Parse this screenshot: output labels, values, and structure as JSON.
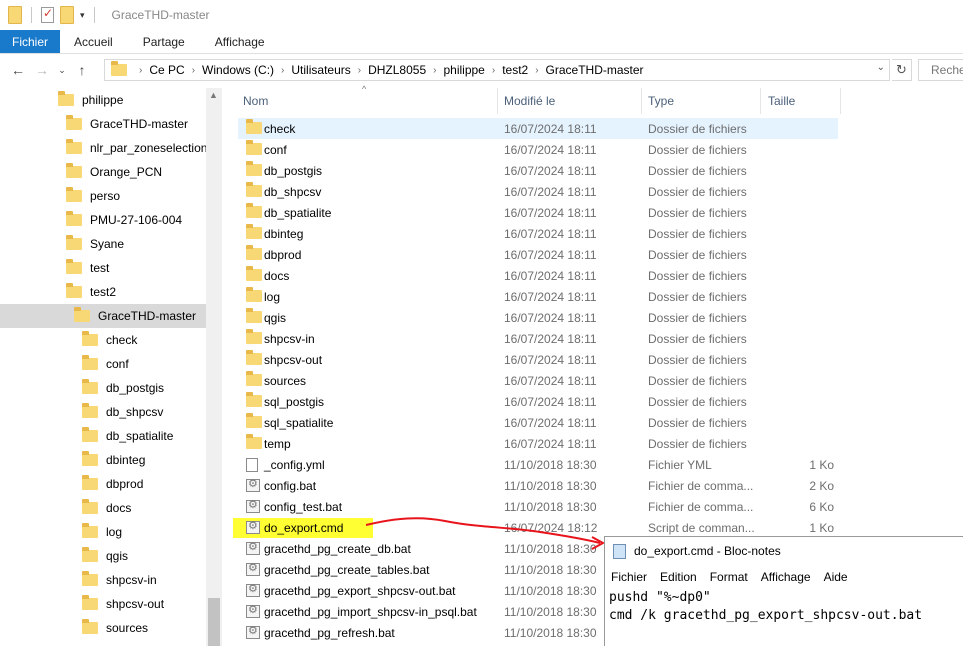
{
  "window": {
    "title": "GraceTHD-master"
  },
  "ribbon": {
    "tabs": [
      "Fichier",
      "Accueil",
      "Partage",
      "Affichage"
    ]
  },
  "address": {
    "crumbs": [
      "Ce PC",
      "Windows (C:)",
      "Utilisateurs",
      "DHZL8055",
      "philippe",
      "test2",
      "GraceTHD-master"
    ],
    "search_placeholder": "Reche"
  },
  "sidebar": {
    "items": [
      {
        "label": "philippe",
        "level": 0
      },
      {
        "label": "GraceTHD-master",
        "level": 1
      },
      {
        "label": "nlr_par_zoneselection_p",
        "level": 1
      },
      {
        "label": "Orange_PCN",
        "level": 1
      },
      {
        "label": "perso",
        "level": 1
      },
      {
        "label": "PMU-27-106-004",
        "level": 1
      },
      {
        "label": "Syane",
        "level": 1
      },
      {
        "label": "test",
        "level": 1
      },
      {
        "label": "test2",
        "level": 1
      },
      {
        "label": "GraceTHD-master",
        "level": 2,
        "selected": true
      },
      {
        "label": "check",
        "level": 3
      },
      {
        "label": "conf",
        "level": 3
      },
      {
        "label": "db_postgis",
        "level": 3
      },
      {
        "label": "db_shpcsv",
        "level": 3
      },
      {
        "label": "db_spatialite",
        "level": 3
      },
      {
        "label": "dbinteg",
        "level": 3
      },
      {
        "label": "dbprod",
        "level": 3
      },
      {
        "label": "docs",
        "level": 3
      },
      {
        "label": "log",
        "level": 3
      },
      {
        "label": "qgis",
        "level": 3
      },
      {
        "label": "shpcsv-in",
        "level": 3
      },
      {
        "label": "shpcsv-out",
        "level": 3
      },
      {
        "label": "sources",
        "level": 3
      }
    ]
  },
  "columns": {
    "name": "Nom",
    "modified": "Modifié le",
    "type": "Type",
    "size": "Taille"
  },
  "files": [
    {
      "name": "check",
      "date": "16/07/2024 18:11",
      "type": "Dossier de fichiers",
      "size": "",
      "kind": "folder",
      "highlighted": true
    },
    {
      "name": "conf",
      "date": "16/07/2024 18:11",
      "type": "Dossier de fichiers",
      "size": "",
      "kind": "folder"
    },
    {
      "name": "db_postgis",
      "date": "16/07/2024 18:11",
      "type": "Dossier de fichiers",
      "size": "",
      "kind": "folder"
    },
    {
      "name": "db_shpcsv",
      "date": "16/07/2024 18:11",
      "type": "Dossier de fichiers",
      "size": "",
      "kind": "folder"
    },
    {
      "name": "db_spatialite",
      "date": "16/07/2024 18:11",
      "type": "Dossier de fichiers",
      "size": "",
      "kind": "folder"
    },
    {
      "name": "dbinteg",
      "date": "16/07/2024 18:11",
      "type": "Dossier de fichiers",
      "size": "",
      "kind": "folder"
    },
    {
      "name": "dbprod",
      "date": "16/07/2024 18:11",
      "type": "Dossier de fichiers",
      "size": "",
      "kind": "folder"
    },
    {
      "name": "docs",
      "date": "16/07/2024 18:11",
      "type": "Dossier de fichiers",
      "size": "",
      "kind": "folder"
    },
    {
      "name": "log",
      "date": "16/07/2024 18:11",
      "type": "Dossier de fichiers",
      "size": "",
      "kind": "folder"
    },
    {
      "name": "qgis",
      "date": "16/07/2024 18:11",
      "type": "Dossier de fichiers",
      "size": "",
      "kind": "folder"
    },
    {
      "name": "shpcsv-in",
      "date": "16/07/2024 18:11",
      "type": "Dossier de fichiers",
      "size": "",
      "kind": "folder"
    },
    {
      "name": "shpcsv-out",
      "date": "16/07/2024 18:11",
      "type": "Dossier de fichiers",
      "size": "",
      "kind": "folder"
    },
    {
      "name": "sources",
      "date": "16/07/2024 18:11",
      "type": "Dossier de fichiers",
      "size": "",
      "kind": "folder"
    },
    {
      "name": "sql_postgis",
      "date": "16/07/2024 18:11",
      "type": "Dossier de fichiers",
      "size": "",
      "kind": "folder"
    },
    {
      "name": "sql_spatialite",
      "date": "16/07/2024 18:11",
      "type": "Dossier de fichiers",
      "size": "",
      "kind": "folder"
    },
    {
      "name": "temp",
      "date": "16/07/2024 18:11",
      "type": "Dossier de fichiers",
      "size": "",
      "kind": "folder"
    },
    {
      "name": "_config.yml",
      "date": "11/10/2018 18:30",
      "type": "Fichier YML",
      "size": "1 Ko",
      "kind": "file"
    },
    {
      "name": "config.bat",
      "date": "11/10/2018 18:30",
      "type": "Fichier de comma...",
      "size": "2 Ko",
      "kind": "bat"
    },
    {
      "name": "config_test.bat",
      "date": "11/10/2018 18:30",
      "type": "Fichier de comma...",
      "size": "6 Ko",
      "kind": "bat"
    },
    {
      "name": "do_export.cmd",
      "date": "16/07/2024 18:12",
      "type": "Script de comman...",
      "size": "1 Ko",
      "kind": "bat"
    },
    {
      "name": "gracethd_pg_create_db.bat",
      "date": "11/10/2018 18:30",
      "type": "",
      "size": "",
      "kind": "bat"
    },
    {
      "name": "gracethd_pg_create_tables.bat",
      "date": "11/10/2018 18:30",
      "type": "",
      "size": "",
      "kind": "bat"
    },
    {
      "name": "gracethd_pg_export_shpcsv-out.bat",
      "date": "11/10/2018 18:30",
      "type": "",
      "size": "",
      "kind": "bat"
    },
    {
      "name": "gracethd_pg_import_shpcsv-in_psql.bat",
      "date": "11/10/2018 18:30",
      "type": "",
      "size": "",
      "kind": "bat"
    },
    {
      "name": "gracethd_pg_refresh.bat",
      "date": "11/10/2018 18:30",
      "type": "",
      "size": "",
      "kind": "bat"
    }
  ],
  "notepad": {
    "title": "do_export.cmd - Bloc-notes",
    "menu": [
      "Fichier",
      "Edition",
      "Format",
      "Affichage",
      "Aide"
    ],
    "lines": [
      "pushd \"%~dp0\"",
      "cmd /k gracethd_pg_export_shpcsv-out.bat"
    ]
  },
  "colors": {
    "accent": "#1979ca",
    "folder": "#f8d775",
    "highlight": "#ffff33",
    "annotation": "#e8141c"
  }
}
